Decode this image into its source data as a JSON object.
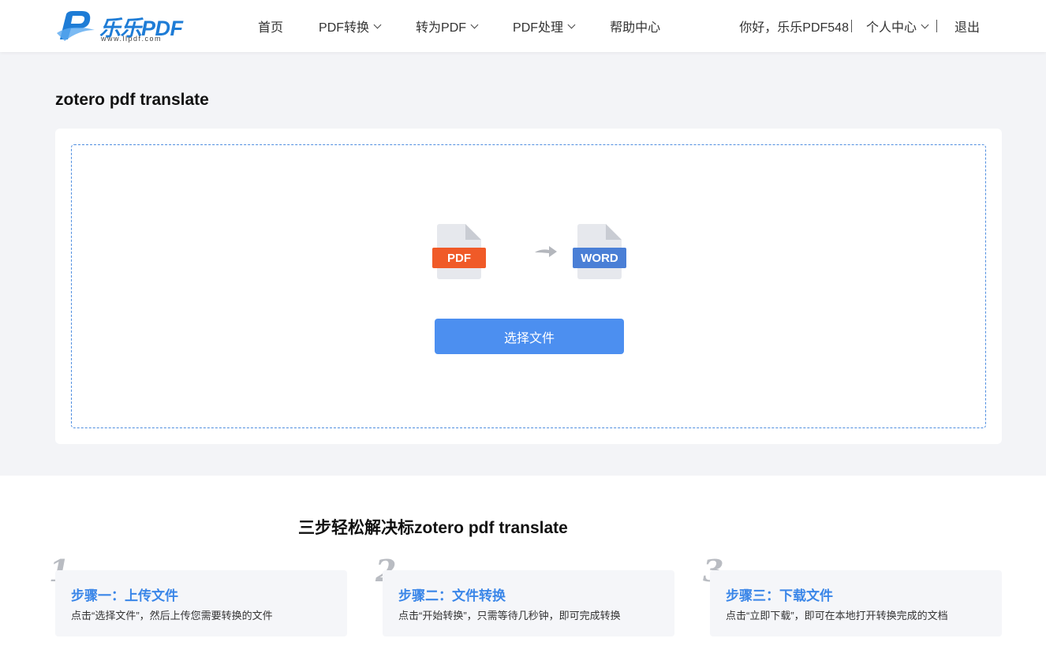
{
  "header": {
    "logo_text": "乐乐PDF",
    "logo_url": "www.llpdf.com",
    "nav": [
      {
        "label": "首页",
        "dropdown": false
      },
      {
        "label": "PDF转换",
        "dropdown": true
      },
      {
        "label": "转为PDF",
        "dropdown": true
      },
      {
        "label": "PDF处理",
        "dropdown": true
      },
      {
        "label": "帮助中心",
        "dropdown": false
      }
    ],
    "greeting": "你好，乐乐PDF548",
    "user_center": "个人中心",
    "logout": "退出"
  },
  "main": {
    "title": "zotero pdf translate",
    "source_label": "PDF",
    "target_label": "WORD",
    "select_button": "选择文件"
  },
  "steps": {
    "title": "三步轻松解决标zotero pdf translate",
    "items": [
      {
        "num": "1",
        "title": "步骤一：上传文件",
        "desc": "点击“选择文件”，然后上传您需要转换的文件"
      },
      {
        "num": "2",
        "title": "步骤二：文件转换",
        "desc": "点击“开始转换”，只需等待几秒钟，即可完成转换"
      },
      {
        "num": "3",
        "title": "步骤三：下载文件",
        "desc": "点击“立即下载”，即可在本地打开转换完成的文档"
      }
    ]
  },
  "colors": {
    "accent": "#4c8ff0",
    "pdf": "#f05a28",
    "word": "#4a7fd6"
  },
  "icons": {
    "pdf": "pdf-file-icon",
    "word": "word-file-icon",
    "arrow": "arrow-right-icon"
  }
}
